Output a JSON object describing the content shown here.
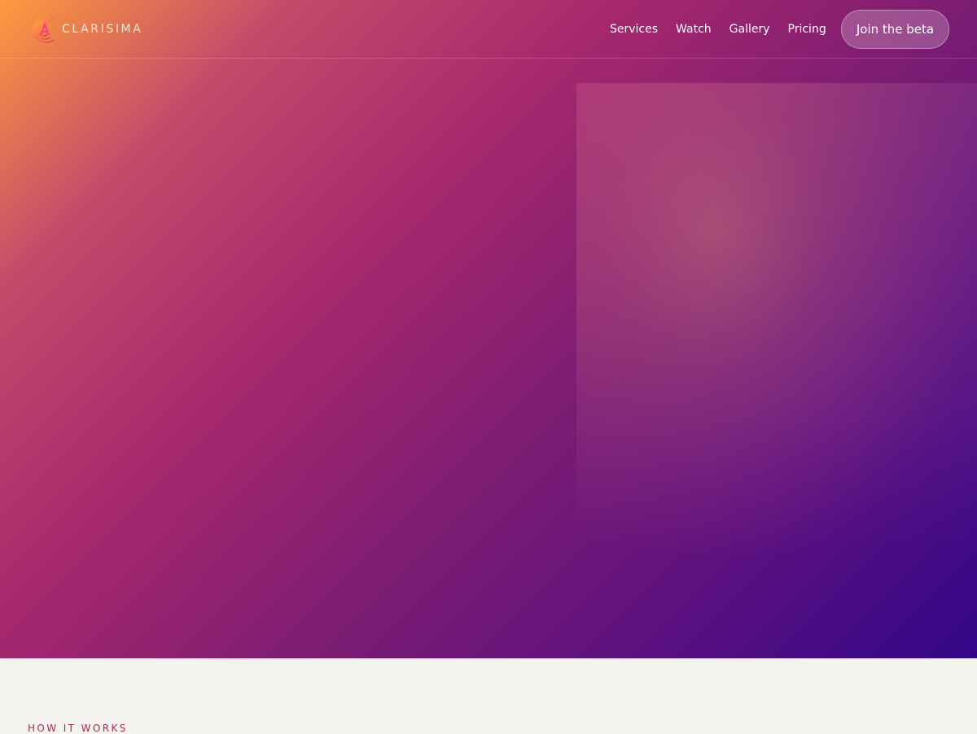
{
  "brand": {
    "name": "CLARISIMA",
    "logo_icon": "clarisima-logo-icon",
    "colors": {
      "text": "#ffe7d6",
      "accent": "#a32a5f"
    }
  },
  "nav": {
    "items": [
      {
        "label": "Services"
      },
      {
        "label": "Watch"
      },
      {
        "label": "Gallery"
      },
      {
        "label": "Pricing"
      }
    ],
    "cta_label": "Join the beta"
  },
  "hero": {
    "gradient_colors": [
      "#ff9b3d",
      "#a6286d",
      "#7b1c73",
      "#320688"
    ]
  },
  "section": {
    "eyebrow": "HOW IT WORKS",
    "background": "#f5f3ef"
  }
}
